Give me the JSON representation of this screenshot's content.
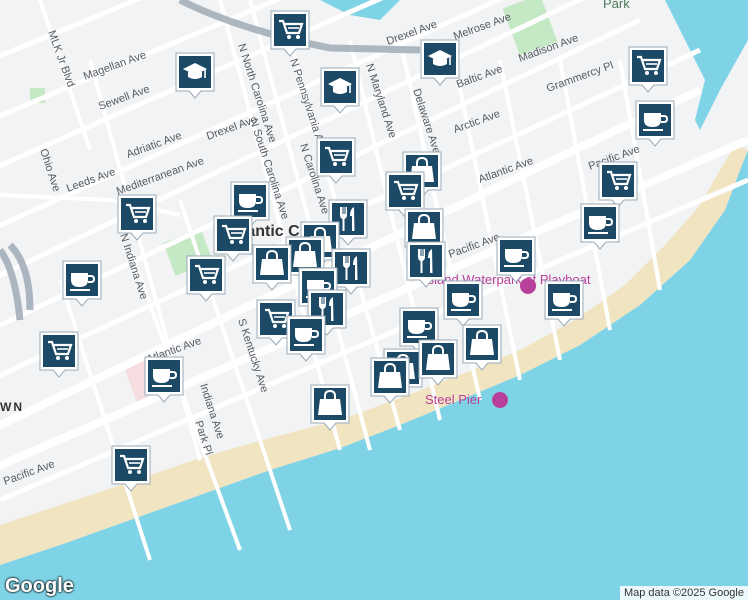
{
  "map": {
    "city_label": "Atlantic Ci",
    "neighborhood_label": "WN",
    "park_label": "Park",
    "poi_labels": [
      {
        "id": "waterpark",
        "text": "Island Waterpark at Playboat"
      },
      {
        "id": "steel-pier",
        "text": "Steel Pier"
      }
    ],
    "street_labels": [
      "MLK Jr Blvd",
      "Magellan Ave",
      "Sewell Ave",
      "Adriatic Ave",
      "Drexel Ave",
      "Melrose Ave",
      "Baltic Ave",
      "Madison Ave",
      "Grammercy Pl",
      "Arctic Ave",
      "Atlantic Ave",
      "Pacific Ave",
      "Delaware Ave",
      "N Maryland Ave",
      "N Pennsylvania Ave",
      "N North Carolina Ave",
      "N South Carolina Ave",
      "N Carolina Ave",
      "Mediterranean Ave",
      "Leeds Ave",
      "Ohio Ave",
      "N Indiana Ave",
      "Indiana Ave",
      "S Kentucky Ave",
      "Park Pl"
    ],
    "colors": {
      "water": "#7fd3e6",
      "land": "#f2f3f4",
      "sand": "#f1e4c0",
      "park": "#c5e8c5",
      "road": "#ffffff",
      "marker": "#1c4a66",
      "poi": "#b8409a"
    }
  },
  "markers": [
    {
      "type": "shopping-cart",
      "name": "grocery"
    },
    {
      "type": "graduation-cap",
      "name": "school"
    },
    {
      "type": "coffee-cup",
      "name": "cafe"
    },
    {
      "type": "shopping-bag",
      "name": "shop"
    },
    {
      "type": "fork-knife",
      "name": "restaurant"
    }
  ],
  "attribution": {
    "logo": "Google",
    "map_data": "Map data ©2025 Google"
  }
}
